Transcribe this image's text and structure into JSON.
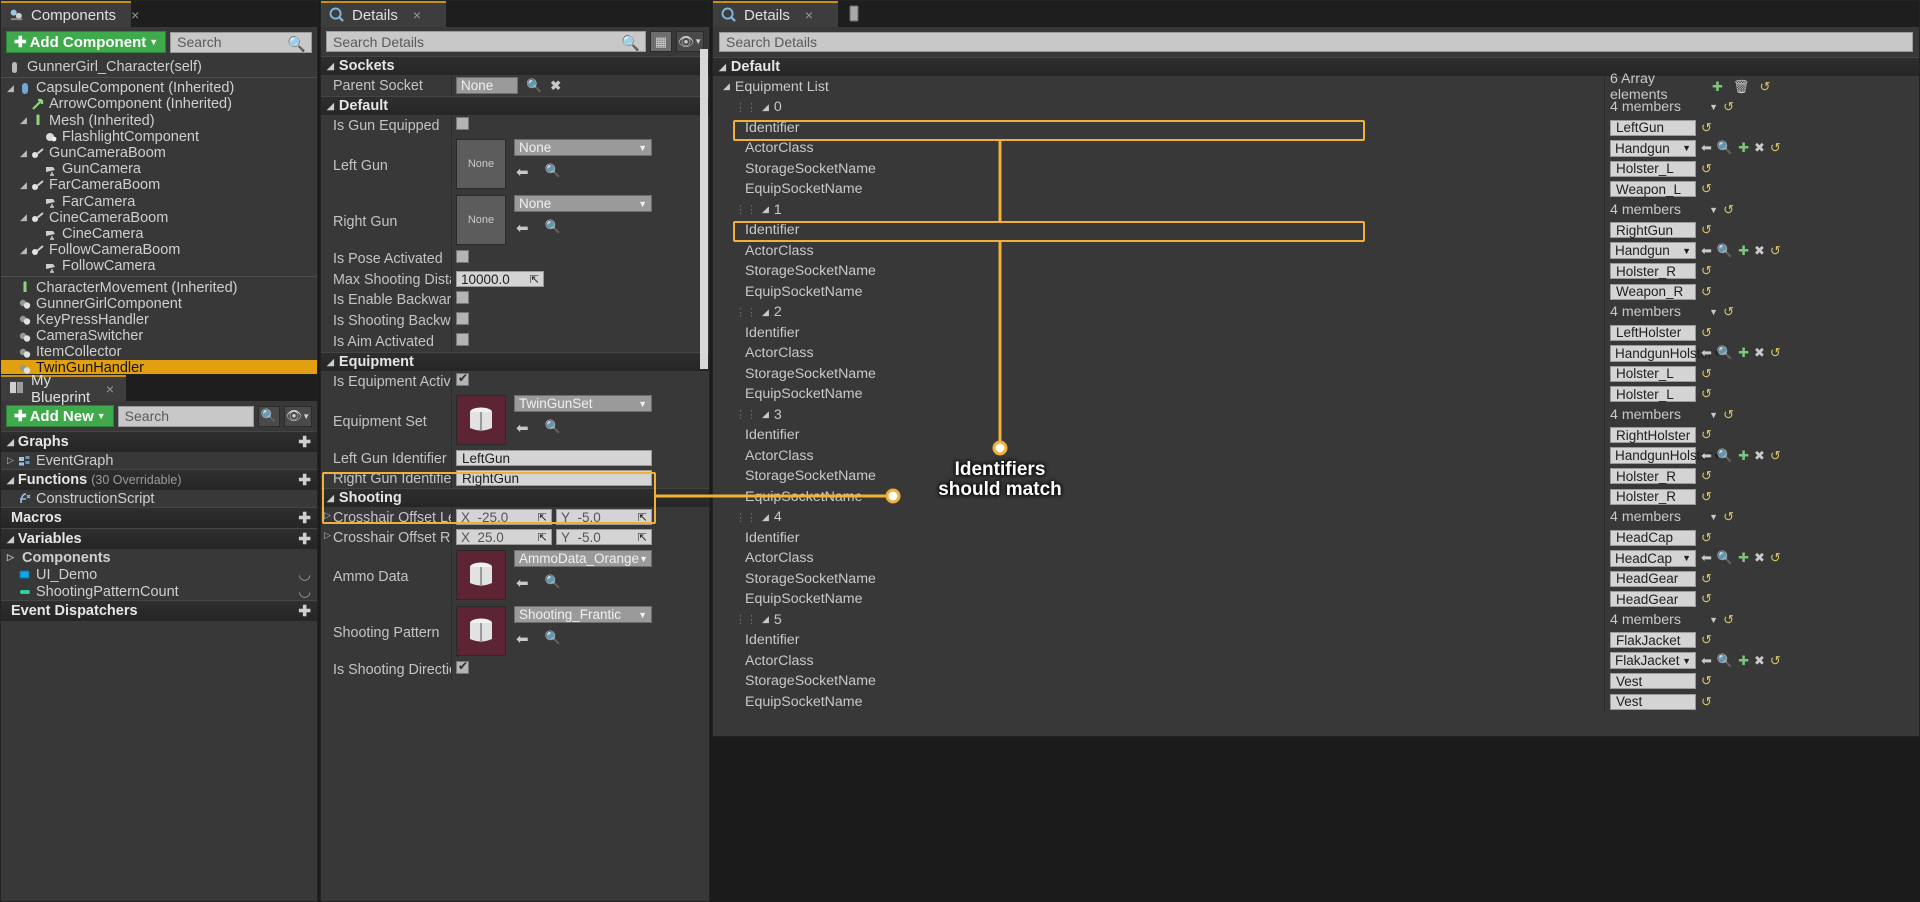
{
  "components_panel": {
    "tab_label": "Components",
    "tab_icon": "components-icon",
    "add_button": "Add Component",
    "search_placeholder": "Search",
    "root": "GunnerGirl_Character(self)",
    "items": [
      {
        "label": "CapsuleComponent (Inherited)",
        "depth": 0,
        "arrow": true,
        "icon": "capsule-icon"
      },
      {
        "label": "ArrowComponent (Inherited)",
        "depth": 1,
        "arrow": false,
        "icon": "arrow-component-icon"
      },
      {
        "label": "Mesh (Inherited)",
        "depth": 1,
        "arrow": true,
        "icon": "mesh-icon"
      },
      {
        "label": "FlashlightComponent",
        "depth": 2,
        "arrow": false,
        "icon": "light-icon"
      },
      {
        "label": "GunCameraBoom",
        "depth": 1,
        "arrow": true,
        "icon": "boom-icon"
      },
      {
        "label": "GunCamera",
        "depth": 2,
        "arrow": false,
        "icon": "camera-icon"
      },
      {
        "label": "FarCameraBoom",
        "depth": 1,
        "arrow": true,
        "icon": "boom-icon"
      },
      {
        "label": "FarCamera",
        "depth": 2,
        "arrow": false,
        "icon": "camera-icon"
      },
      {
        "label": "CineCameraBoom",
        "depth": 1,
        "arrow": true,
        "icon": "boom-icon"
      },
      {
        "label": "CineCamera",
        "depth": 2,
        "arrow": false,
        "icon": "camera-icon"
      },
      {
        "label": "FollowCameraBoom",
        "depth": 1,
        "arrow": true,
        "icon": "boom-icon"
      },
      {
        "label": "FollowCamera",
        "depth": 2,
        "arrow": false,
        "icon": "camera-icon"
      }
    ],
    "items2": [
      {
        "label": "CharacterMovement (Inherited)",
        "depth": 0,
        "arrow": false,
        "icon": "movement-icon",
        "selected": false
      },
      {
        "label": "GunnerGirlComponent",
        "depth": 0,
        "arrow": false,
        "icon": "actorcomp-icon",
        "selected": false
      },
      {
        "label": "KeyPressHandler",
        "depth": 0,
        "arrow": false,
        "icon": "actorcomp-icon",
        "selected": false
      },
      {
        "label": "CameraSwitcher",
        "depth": 0,
        "arrow": false,
        "icon": "actorcomp-icon",
        "selected": false
      },
      {
        "label": "ItemCollector",
        "depth": 0,
        "arrow": false,
        "icon": "actorcomp-icon",
        "selected": false
      },
      {
        "label": "TwinGunHandler",
        "depth": 0,
        "arrow": false,
        "icon": "actorcomp-icon",
        "selected": true
      }
    ]
  },
  "myblueprint_panel": {
    "tab_label": "My Blueprint",
    "tab_icon": "book-icon",
    "add_button": "Add New",
    "search_placeholder": "Search",
    "sections": [
      {
        "name": "Graphs",
        "caret": "down",
        "suffix": "",
        "items": [
          {
            "label": "EventGraph",
            "icon": "eventgraph-icon",
            "arrow": "right"
          }
        ]
      },
      {
        "name": "Functions",
        "caret": "down",
        "suffix": "(30 Overridable)",
        "items": [
          {
            "label": "ConstructionScript",
            "icon": "function-icon",
            "arrow": ""
          }
        ]
      },
      {
        "name": "Macros",
        "caret": "none",
        "suffix": "",
        "items": []
      },
      {
        "name": "Variables",
        "caret": "down",
        "suffix": "",
        "items": [
          {
            "label": "Components",
            "icon": "",
            "arrow": "right"
          },
          {
            "label": "UI_Demo",
            "icon": "object-pin-icon",
            "arrow": ""
          },
          {
            "label": "ShootingPatternCount",
            "icon": "int-pin-icon",
            "arrow": ""
          }
        ]
      },
      {
        "name": "Event Dispatchers",
        "caret": "none",
        "suffix": "",
        "items": []
      }
    ]
  },
  "details_mid": {
    "tab_label": "Details",
    "tab_icon": "details-icon",
    "search_placeholder": "Search Details",
    "sections": [
      {
        "title": "Sockets",
        "rows": [
          {
            "name": "Parent Socket",
            "type": "asset-ref-none",
            "value": "None"
          }
        ]
      },
      {
        "title": "Default",
        "rows": [
          {
            "name": "Is Gun Equipped",
            "type": "checkbox",
            "checked": false
          },
          {
            "name": "Left Gun",
            "type": "asset",
            "value": "None",
            "thumb": "None"
          },
          {
            "name": "Right Gun",
            "type": "asset",
            "value": "None",
            "thumb": "None"
          },
          {
            "name": "Is Pose Activated",
            "type": "checkbox",
            "checked": false
          },
          {
            "name": "Max Shooting Distance",
            "type": "number",
            "value": "10000.0"
          },
          {
            "name": "Is Enable Backward Shooting",
            "type": "checkbox",
            "checked": false
          },
          {
            "name": "Is Shooting Backward",
            "type": "checkbox",
            "checked": false
          },
          {
            "name": "Is Aim Activated",
            "type": "checkbox",
            "checked": false
          }
        ]
      },
      {
        "title": "Equipment",
        "rows": [
          {
            "name": "Is Equipment Active",
            "type": "checkbox",
            "checked": true
          },
          {
            "name": "Equipment Set",
            "type": "asset-colored",
            "value": "TwinGunSet"
          },
          {
            "name": "Left Gun Identifier",
            "type": "text",
            "value": "LeftGun",
            "highlight": true
          },
          {
            "name": "Right Gun Identifier",
            "type": "text",
            "value": "RightGun",
            "highlight": true
          }
        ]
      },
      {
        "title": "Shooting",
        "rows": [
          {
            "name": "Crosshair Offset Left",
            "type": "vec2",
            "x": "-25.0",
            "y": "-5.0",
            "expand": true
          },
          {
            "name": "Crosshair Offset Right",
            "type": "vec2",
            "x": "25.0",
            "y": "-5.0",
            "expand": true
          },
          {
            "name": "Ammo Data",
            "type": "asset-colored",
            "value": "AmmoData_Orange"
          },
          {
            "name": "Shooting Pattern",
            "type": "asset-colored",
            "value": "Shooting_Frantic"
          },
          {
            "name": "Is Shooting Direction Adjusted",
            "type": "checkbox",
            "checked": true
          }
        ]
      }
    ]
  },
  "details_right": {
    "tab_label": "Details",
    "tab_icon": "details-icon",
    "search_placeholder": "Search Details",
    "section_title": "Default",
    "array_name": "Equipment List",
    "array_count": "6 Array elements",
    "member_count": "4 members",
    "elements": [
      {
        "index": "0",
        "rows": [
          {
            "label": "Identifier",
            "ctrl": "text",
            "value": "LeftGun",
            "reset": true,
            "highlight": true
          },
          {
            "label": "ActorClass",
            "ctrl": "dropdown",
            "value": "Handgun",
            "tools": "class"
          },
          {
            "label": "StorageSocketName",
            "ctrl": "text",
            "value": "Holster_L",
            "reset": true
          },
          {
            "label": "EquipSocketName",
            "ctrl": "text",
            "value": "Weapon_L",
            "reset": true
          }
        ]
      },
      {
        "index": "1",
        "rows": [
          {
            "label": "Identifier",
            "ctrl": "text",
            "value": "RightGun",
            "reset": true,
            "highlight": true
          },
          {
            "label": "ActorClass",
            "ctrl": "dropdown",
            "value": "Handgun",
            "tools": "class"
          },
          {
            "label": "StorageSocketName",
            "ctrl": "text",
            "value": "Holster_R",
            "reset": true
          },
          {
            "label": "EquipSocketName",
            "ctrl": "text",
            "value": "Weapon_R",
            "reset": true
          }
        ]
      },
      {
        "index": "2",
        "rows": [
          {
            "label": "Identifier",
            "ctrl": "text",
            "value": "LeftHolster",
            "reset": true
          },
          {
            "label": "ActorClass",
            "ctrl": "dropdown",
            "value": "HandgunHolster",
            "tools": "class"
          },
          {
            "label": "StorageSocketName",
            "ctrl": "text",
            "value": "Holster_L",
            "reset": true
          },
          {
            "label": "EquipSocketName",
            "ctrl": "text",
            "value": "Holster_L",
            "reset": true
          }
        ]
      },
      {
        "index": "3",
        "rows": [
          {
            "label": "Identifier",
            "ctrl": "text",
            "value": "RightHolster",
            "reset": true
          },
          {
            "label": "ActorClass",
            "ctrl": "dropdown",
            "value": "HandgunHolster",
            "tools": "class"
          },
          {
            "label": "StorageSocketName",
            "ctrl": "text",
            "value": "Holster_R",
            "reset": true
          },
          {
            "label": "EquipSocketName",
            "ctrl": "text",
            "value": "Holster_R",
            "reset": true
          }
        ]
      },
      {
        "index": "4",
        "rows": [
          {
            "label": "Identifier",
            "ctrl": "text",
            "value": "HeadCap",
            "reset": true
          },
          {
            "label": "ActorClass",
            "ctrl": "dropdown",
            "value": "HeadCap",
            "tools": "class"
          },
          {
            "label": "StorageSocketName",
            "ctrl": "text",
            "value": "HeadGear",
            "reset": true
          },
          {
            "label": "EquipSocketName",
            "ctrl": "text",
            "value": "HeadGear",
            "reset": true
          }
        ]
      },
      {
        "index": "5",
        "rows": [
          {
            "label": "Identifier",
            "ctrl": "text",
            "value": "FlakJacket",
            "reset": true
          },
          {
            "label": "ActorClass",
            "ctrl": "dropdown",
            "value": "FlakJacket",
            "tools": "class"
          },
          {
            "label": "StorageSocketName",
            "ctrl": "text",
            "value": "Vest",
            "reset": true
          },
          {
            "label": "EquipSocketName",
            "ctrl": "text",
            "value": "Vest",
            "reset": true
          }
        ]
      }
    ]
  },
  "annotation": {
    "line1": "Identifiers",
    "line2": "should match",
    "color": "#f0b03a"
  }
}
